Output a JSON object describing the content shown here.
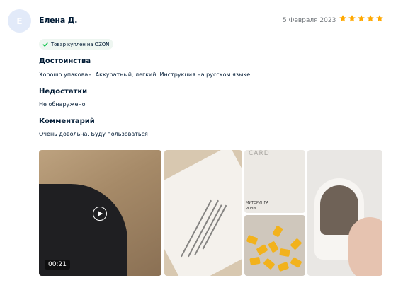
{
  "review": {
    "avatar_letter": "Е",
    "author": "Елена Д.",
    "date": "5 Февраля 2023",
    "rating": 5,
    "rating_max": 5,
    "badge": "Товар куплен на OZON",
    "pros_title": "Достоинства",
    "pros_text": "Хорошо упакован. Аккуратный, легкий. Инструкция на русском языке",
    "cons_title": "Недостатки",
    "cons_text": "Не обнаружено",
    "comment_title": "Комментарий",
    "comment_text": "Очень довольна. Буду пользоваться"
  },
  "media": {
    "video_duration": "00:21",
    "photo2_caption": "CARD",
    "photo2_lines": [
      "МИТОРИНГА",
      "РОВИ"
    ]
  },
  "colors": {
    "star": "#ffa800",
    "check": "#10c44c",
    "avatar_bg": "#e2eaf9",
    "text": "#001a34",
    "muted": "#70757a"
  }
}
